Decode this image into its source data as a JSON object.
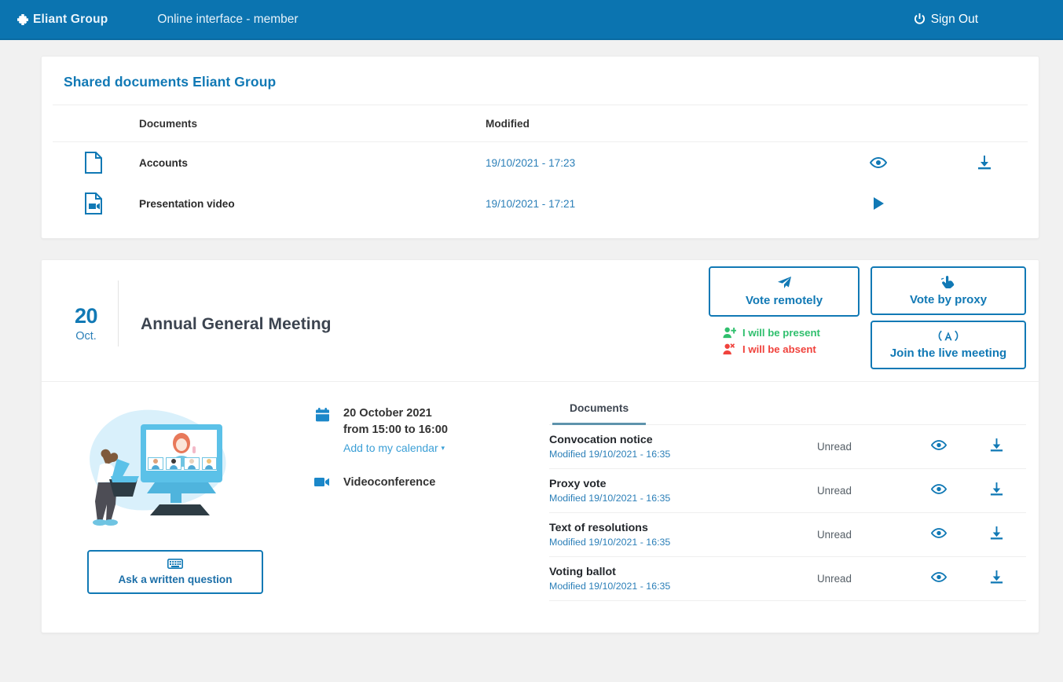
{
  "topbar": {
    "brand": "Eliant Group",
    "brand_icon": "puzzle-cross-icon",
    "subtitle": "Online interface - member",
    "signout_label": "Sign Out",
    "signout_icon": "power-icon",
    "bg_color": "#0b74b0"
  },
  "shared": {
    "title": "Shared documents Eliant Group",
    "columns": {
      "icon": "",
      "documents": "Documents",
      "modified": "Modified"
    },
    "rows": [
      {
        "icon": "file-icon",
        "name": "Accounts",
        "modified": "19/10/2021 - 17:23",
        "action1": "eye-icon",
        "action2": "download-icon"
      },
      {
        "icon": "file-video-icon",
        "name": "Presentation video",
        "modified": "19/10/2021 - 17:21",
        "action1": "play-icon",
        "action2": ""
      }
    ]
  },
  "meeting": {
    "date_day": "20",
    "date_month": "Oct.",
    "title": "Annual General Meeting",
    "buttons": {
      "vote_remotely": {
        "label": "Vote remotely",
        "icon": "paper-plane-icon"
      },
      "vote_proxy": {
        "label": "Vote by proxy",
        "icon": "hand-pointer-icon"
      },
      "join_live": {
        "label": "Join the live meeting",
        "icon": "broadcast-icon"
      },
      "ask_question": {
        "label": "Ask a written question",
        "icon": "keyboard-icon"
      }
    },
    "presence": {
      "present": {
        "label": "I will be present",
        "icon": "user-plus-icon",
        "color": "#2fbf6d"
      },
      "absent": {
        "label": "I will be absent",
        "icon": "user-times-icon",
        "color": "#f0423c"
      }
    },
    "illustration": "videoconference-illustration",
    "info": {
      "calendar_icon": "calendar-icon",
      "date_line": "20 October 2021",
      "time_line": "from 15:00 to 16:00",
      "calendar_link": "Add to my calendar",
      "calendar_caret": "▾",
      "video_icon": "video-camera-icon",
      "mode": "Videoconference"
    },
    "documents": {
      "tab_label": "Documents",
      "rows": [
        {
          "name": "Convocation notice",
          "modified": "Modified 19/10/2021 - 16:35",
          "state": "Unread",
          "action1": "eye-icon",
          "action2": "download-icon"
        },
        {
          "name": "Proxy vote",
          "modified": "Modified 19/10/2021 - 16:35",
          "state": "Unread",
          "action1": "eye-icon",
          "action2": "download-icon"
        },
        {
          "name": "Text of resolutions",
          "modified": "Modified 19/10/2021 - 16:35",
          "state": "Unread",
          "action1": "eye-icon",
          "action2": "download-icon"
        },
        {
          "name": "Voting ballot",
          "modified": "Modified 19/10/2021 - 16:35",
          "state": "Unread",
          "action1": "eye-icon",
          "action2": "download-icon"
        }
      ]
    }
  },
  "colors": {
    "primary": "#0b74b0",
    "link": "#2b7fb8",
    "accent": "#1179b5",
    "green": "#2fbf6d",
    "red": "#f0423c"
  }
}
